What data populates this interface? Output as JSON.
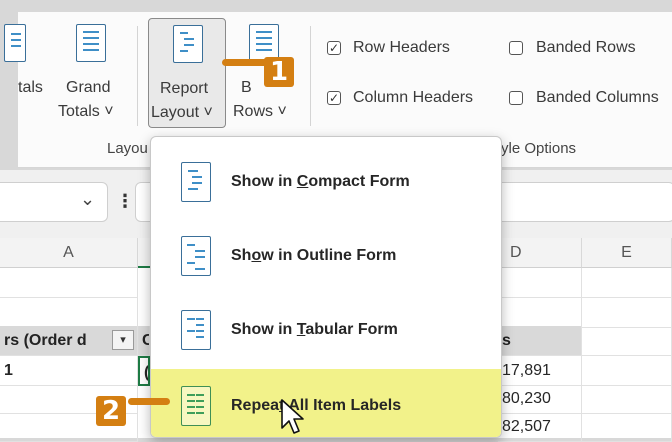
{
  "ribbon": {
    "subtotals_partial": "tals",
    "grand_totals_line1": "Grand",
    "grand_totals_line2": "Totals ˅",
    "report_layout_line1": "Report",
    "report_layout_line2": "Layout ˅",
    "blank_rows_line1": "B",
    "blank_rows_line2": "Rows ˅",
    "layout_group_partial": "Layou",
    "style_options_partial": "yle Options",
    "row_headers": {
      "label": "Row Headers",
      "checked": true
    },
    "column_headers": {
      "label": "Column Headers",
      "checked": true
    },
    "banded_rows": {
      "label": "Banded Rows",
      "checked": false
    },
    "banded_columns": {
      "label": "Banded Columns",
      "checked": false
    }
  },
  "formula_bar": {
    "dropdown_glyph": "⌵",
    "more_glyph": "⋮"
  },
  "grid": {
    "columns": [
      "A",
      "D",
      "E"
    ],
    "header_cell_a": "rs (Order d",
    "header_cell_b": "C",
    "header_cell_d": "s",
    "row1_a": "1",
    "row1_b": "(",
    "values": [
      "17,891",
      "80,230",
      "82,507"
    ]
  },
  "menu": {
    "items": [
      {
        "pre": "Show in ",
        "u": "C",
        "post": "ompact Form"
      },
      {
        "pre": "Sh",
        "u": "o",
        "post": "w in Outline Form"
      },
      {
        "pre": "Show in ",
        "u": "T",
        "post": "abular Form"
      },
      {
        "pre": "Repea",
        "u": "t",
        "post": " All Item Labels"
      }
    ]
  },
  "callouts": {
    "first": "1",
    "second": "2"
  },
  "colors": {
    "highlight": "#f2f28a",
    "callout": "#d47f12",
    "icon_blue": "#3f8fc7"
  }
}
